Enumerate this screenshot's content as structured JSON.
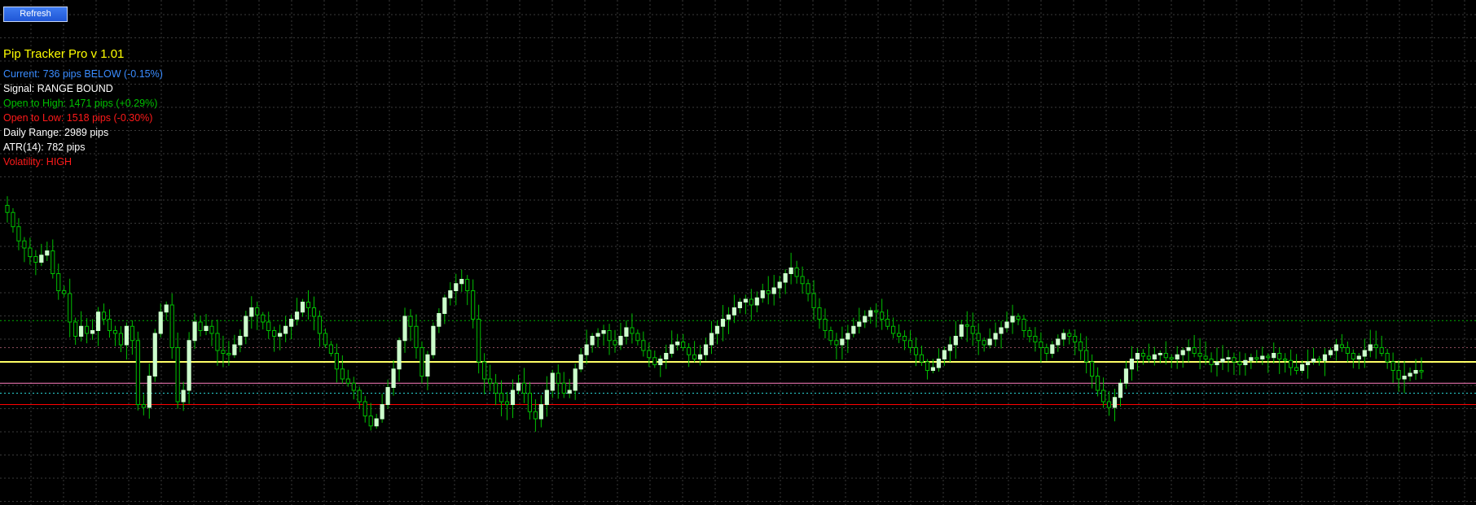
{
  "toolbar": {
    "refresh_label": "Refresh"
  },
  "panel": {
    "title": "Pip Tracker Pro v 1.01",
    "title_color": "#ffff00",
    "lines": [
      {
        "text": "Current: 736 pips BELOW (-0.15%)",
        "color": "#3a8cff"
      },
      {
        "text": "Signal: RANGE BOUND",
        "color": "#ffffff"
      },
      {
        "text": "Open to High: 1471 pips (+0.29%)",
        "color": "#00c000"
      },
      {
        "text": "Open to Low: 1518 pips (-0.30%)",
        "color": "#ff1a1a"
      },
      {
        "text": "Daily Range: 2989 pips",
        "color": "#ffffff"
      },
      {
        "text": "ATR(14): 782 pips",
        "color": "#ffffff"
      },
      {
        "text": "Volatility: HIGH",
        "color": "#ff1a1a"
      }
    ]
  },
  "colors": {
    "background": "#000000",
    "grid": "#3a3a3a",
    "candle_up": "#ccffcc",
    "candle_down": "#00c000",
    "wick": "#00c000",
    "separator": "#8a8a00"
  },
  "chart_data": {
    "type": "candlestick",
    "price_levels": [
      {
        "name": "open-to-high-level",
        "pct": 0.29,
        "color": "#00b000",
        "style": "dotted"
      },
      {
        "name": "upper-dotted-level",
        "pct": 0.1,
        "color": "#8a4a5a",
        "style": "dotted"
      },
      {
        "name": "day-open-level",
        "pct": 0.0,
        "color": "#ffff66",
        "style": "solid"
      },
      {
        "name": "pink-level",
        "pct": -0.15,
        "color": "#ff7fbf",
        "style": "solid"
      },
      {
        "name": "cyan-level",
        "pct": -0.22,
        "color": "#2ad4d4",
        "style": "dotted"
      },
      {
        "name": "open-to-low-level",
        "pct": -0.3,
        "color": "#ff0000",
        "style": "solid"
      }
    ],
    "separator_index": 263,
    "close_pct": [
      1.05,
      0.95,
      0.85,
      0.8,
      0.74,
      0.7,
      0.75,
      0.78,
      0.62,
      0.5,
      0.48,
      0.28,
      0.18,
      0.25,
      0.2,
      0.22,
      0.35,
      0.3,
      0.22,
      0.2,
      0.12,
      0.25,
      0.15,
      -0.3,
      -0.32,
      -0.1,
      0.2,
      0.35,
      0.4,
      0.1,
      -0.28,
      -0.2,
      0.15,
      0.28,
      0.22,
      0.25,
      0.2,
      0.08,
      0.06,
      0.05,
      0.12,
      0.18,
      0.32,
      0.38,
      0.33,
      0.28,
      0.22,
      0.18,
      0.2,
      0.25,
      0.3,
      0.35,
      0.42,
      0.38,
      0.32,
      0.2,
      0.12,
      0.06,
      -0.05,
      -0.12,
      -0.15,
      -0.2,
      -0.28,
      -0.38,
      -0.45,
      -0.4,
      -0.3,
      -0.18,
      -0.05,
      0.15,
      0.32,
      0.25,
      0.1,
      -0.1,
      0.05,
      0.25,
      0.34,
      0.45,
      0.5,
      0.55,
      0.58,
      0.5,
      0.3,
      0.0,
      -0.12,
      -0.15,
      -0.22,
      -0.28,
      -0.3,
      -0.2,
      -0.15,
      -0.22,
      -0.35,
      -0.4,
      -0.3,
      -0.2,
      -0.08,
      -0.15,
      -0.22,
      -0.2,
      -0.05,
      0.05,
      0.12,
      0.18,
      0.2,
      0.22,
      0.15,
      0.12,
      0.18,
      0.24,
      0.2,
      0.15,
      0.08,
      0.03,
      -0.02,
      0.02,
      0.06,
      0.12,
      0.14,
      0.1,
      0.05,
      0.02,
      0.05,
      0.12,
      0.2,
      0.25,
      0.3,
      0.33,
      0.38,
      0.42,
      0.44,
      0.4,
      0.45,
      0.5,
      0.48,
      0.52,
      0.56,
      0.62,
      0.66,
      0.6,
      0.55,
      0.48,
      0.38,
      0.3,
      0.22,
      0.15,
      0.12,
      0.16,
      0.2,
      0.25,
      0.28,
      0.32,
      0.36,
      0.35,
      0.3,
      0.25,
      0.2,
      0.18,
      0.15,
      0.1,
      0.05,
      0.0,
      -0.06,
      -0.04,
      0.02,
      0.08,
      0.12,
      0.18,
      0.26,
      0.25,
      0.2,
      0.15,
      0.12,
      0.16,
      0.2,
      0.24,
      0.28,
      0.32,
      0.3,
      0.22,
      0.18,
      0.14,
      0.1,
      0.06,
      0.12,
      0.16,
      0.2,
      0.18,
      0.14,
      0.08,
      0.0,
      -0.1,
      -0.2,
      -0.28,
      -0.32,
      -0.25,
      -0.15,
      -0.05,
      0.02,
      0.06,
      0.04,
      0.02,
      0.05,
      0.06,
      0.03,
      0.02,
      0.05,
      0.08,
      0.1,
      0.06,
      0.04,
      0.02,
      -0.02,
      0.0,
      0.02,
      0.03,
      0.0,
      -0.02,
      0.01,
      0.03,
      0.02,
      0.04,
      0.03,
      0.06,
      0.02,
      0.01,
      -0.04,
      -0.06,
      -0.02,
      0.0,
      0.02,
      0.01,
      0.05,
      0.08,
      0.12,
      0.1,
      0.06,
      0.02,
      0.04,
      0.08,
      0.12,
      0.1,
      0.06,
      0.0,
      -0.06,
      -0.12,
      -0.1,
      -0.08,
      -0.06,
      -0.07
    ]
  }
}
